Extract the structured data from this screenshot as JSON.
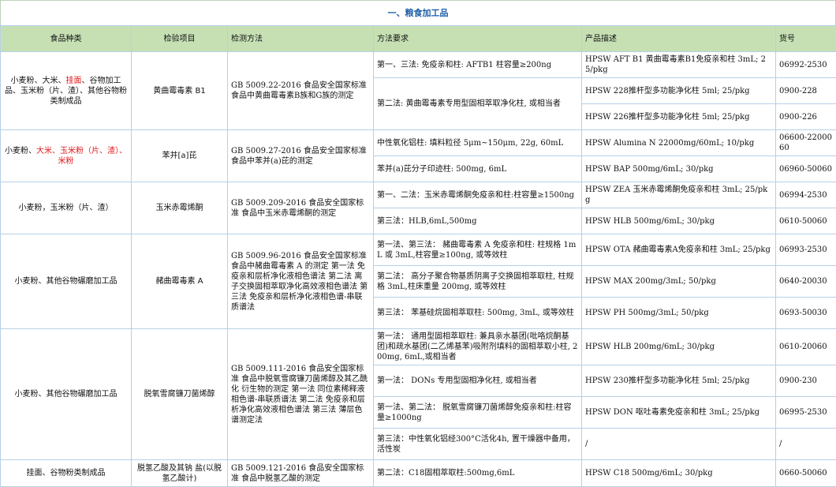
{
  "title": "一、粮食加工品",
  "headers": [
    "食品种类",
    "检验项目",
    "检测方法",
    "方法要求",
    "产品描述",
    "货号"
  ],
  "groups": [
    {
      "category_parts": [
        {
          "text": "小麦粉、大米、",
          "red": false
        },
        {
          "text": "挂面",
          "red": true
        },
        {
          "text": "、谷物加工品、玉米粉（片、渣）、其他谷物粉类制成品",
          "red": false
        }
      ],
      "item": "黄曲霉毒素 B1",
      "method": "GB 5009.22-2016 食品安全国家标准 食品中黄曲霉毒素B族和G族的测定",
      "rows": [
        {
          "requirement": "第一、三法: 免疫亲和柱: AFTB1 柱容量≥200ng",
          "product": "HPSW AFT B1 黄曲霉毒素B1免疫亲和柱 3mL; 25/pkg",
          "code": "06992-2530"
        },
        {
          "requirement": "第二法: 黄曲霉毒素专用型固相萃取净化柱, 或相当者",
          "product": "HPSW 228推杆型多功能净化柱 5ml; 25/pkg",
          "code": "0900-228"
        },
        {
          "requirement": null,
          "product": "HPSW 226推杆型多功能净化柱 5ml; 25/pkg",
          "code": "0900-226"
        }
      ]
    },
    {
      "category_parts": [
        {
          "text": "小麦粉、",
          "red": false
        },
        {
          "text": "大米、玉米粉（片、渣）、米粉",
          "red": true
        }
      ],
      "item": "苯并[a]芘",
      "method": "GB 5009.27-2016 食品安全国家标准 食品中苯并(a)芘的测定",
      "rows": [
        {
          "requirement": "中性氧化铝柱: 填料粒径 5μm~150μm, 22g, 60mL",
          "product": "HPSW Alumina N 22000mg/60mL; 10/pkg",
          "code": "06600-2200060"
        },
        {
          "requirement": "苯并(a)芘分子印迹柱: 500mg, 6mL",
          "product": "HPSW BAP 500mg/6mL; 30/pkg",
          "code": "06960-50060"
        }
      ]
    },
    {
      "category_parts": [
        {
          "text": "小麦粉，玉米粉（片、渣）",
          "red": false
        }
      ],
      "item": "玉米赤霉烯酮",
      "method": "GB 5009.209-2016 食品安全国家标准 食品中玉米赤霉烯酮的测定",
      "rows": [
        {
          "requirement": "第一、二法：玉米赤霉烯酮免疫亲和柱:柱容量≥1500ng",
          "product": "HPSW ZEA 玉米赤霉烯酮免疫亲和柱 3mL; 25/pkg",
          "code": "06994-2530"
        },
        {
          "requirement": "第三法：HLB,6mL,500mg",
          "product": "HPSW HLB 500mg/6mL; 30/pkg",
          "code": "0610-50060"
        }
      ]
    },
    {
      "category_parts": [
        {
          "text": "小麦粉、其他谷物碾磨加工品",
          "red": false
        }
      ],
      "item": "赭曲霉毒素 A",
      "method": "GB 5009.96-2016 食品安全国家标准 食品中赭曲霉毒素 A 的测定 第一法 免疫亲和层析净化液相色谱法 第二法 离子交换固相萃取净化高效液相色谱法 第三法 免疫亲和层析净化液相色谱-串联质谱法",
      "rows": [
        {
          "requirement": "第一法、第三法： 赭曲霉毒素 A 免疫亲和柱: 柱规格 1mL 或 3mL,柱容量≥100ng, 或等效柱",
          "product": "HPSW OTA 赭曲霉毒素A免疫亲和柱 3mL; 25/pkg",
          "code": "06993-2530"
        },
        {
          "requirement": "第二法： 高分子聚合物基质阴离子交换固相萃取柱, 柱规格 3mL,柱床重量 200mg, 或等效柱",
          "product": "HPSW MAX 200mg/3mL; 50/pkg",
          "code": "0640-20030"
        },
        {
          "requirement": "第三法： 苯基硅烷固相萃取柱: 500mg, 3mL, 或等效柱",
          "product": "HPSW PH 500mg/3mL; 50/pkg",
          "code": "0693-50030"
        }
      ]
    },
    {
      "category_parts": [
        {
          "text": "小麦粉、其他谷物碾磨加工品",
          "red": false
        }
      ],
      "item": "脱氧雪腐镰刀菌烯醇",
      "method": "GB 5009.111-2016 食品安全国家标准 食品中脱氧雪腐镰刀菌烯醇及其乙酰化 衍生物的测定 第一法 同位素稀释液相色谱-串联质谱法 第二法 免疫亲和层析净化高效液相色谱法 第三法 薄层色谱测定法",
      "rows": [
        {
          "requirement": "第一法： 通用型固相萃取柱: 兼具亲水基团(吡咯烷酮基团)和疏水基团(二乙烯基苯)吸附剂填料的固相萃取小柱, 200mg, 6mL,或相当者",
          "product": "HPSW HLB 200mg/6mL; 30/pkg",
          "code": "0610-20060"
        },
        {
          "requirement": "第一法： DONs 专用型固相净化柱, 或相当者",
          "product": "HPSW 230推杆型多功能净化柱 5ml; 25/pkg",
          "code": "0900-230"
        },
        {
          "requirement": "第一法、第二法： 脱氧雪腐镰刀菌烯醇免疫亲和柱:柱容量≥1000ng",
          "product": "HPSW DON 呕吐毒素免疫亲和柱 3mL; 25/pkg",
          "code": "06995-2530"
        },
        {
          "requirement": "第三法：中性氧化铝经300°C活化4h, 置干燥器中备用，活性炭",
          "product": "/",
          "code": "/"
        }
      ]
    },
    {
      "category_parts": [
        {
          "text": "挂面、谷物粉类制成品",
          "red": false
        }
      ],
      "item": "脱氢乙酸及其钠 盐(以脱氢乙酸计)",
      "method": "GB 5009.121-2016 食品安全国家标准 食品中脱氢乙酸的测定",
      "rows": [
        {
          "requirement": "第二法：C18固相萃取柱:500mg,6mL",
          "product": "HPSW C18 500mg/6mL; 30/pkg",
          "code": "0660-50060"
        }
      ]
    }
  ]
}
